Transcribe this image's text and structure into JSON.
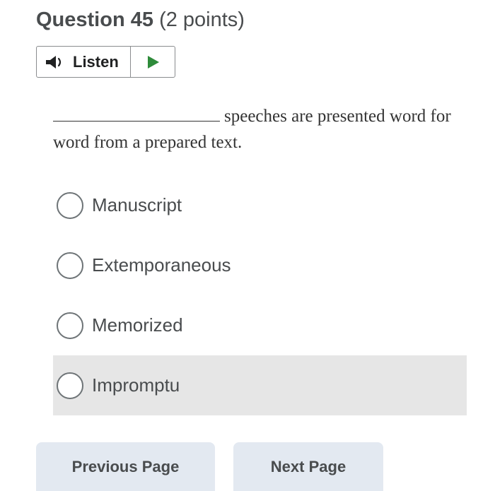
{
  "question": {
    "number_label": "Question 45",
    "points_label": "(2 points)",
    "text_after_blank": "speeches are presented word for word from a prepared text."
  },
  "listen": {
    "label": "Listen",
    "speaker_icon": "speaker-icon",
    "play_icon": "play-icon",
    "play_color": "#2e8b3a"
  },
  "choices": [
    {
      "label": "Manuscript",
      "hovered": false
    },
    {
      "label": "Extemporaneous",
      "hovered": false
    },
    {
      "label": "Memorized",
      "hovered": false
    },
    {
      "label": "Impromptu",
      "hovered": true
    }
  ],
  "nav": {
    "previous_label": "Previous Page",
    "next_label": "Next Page"
  }
}
